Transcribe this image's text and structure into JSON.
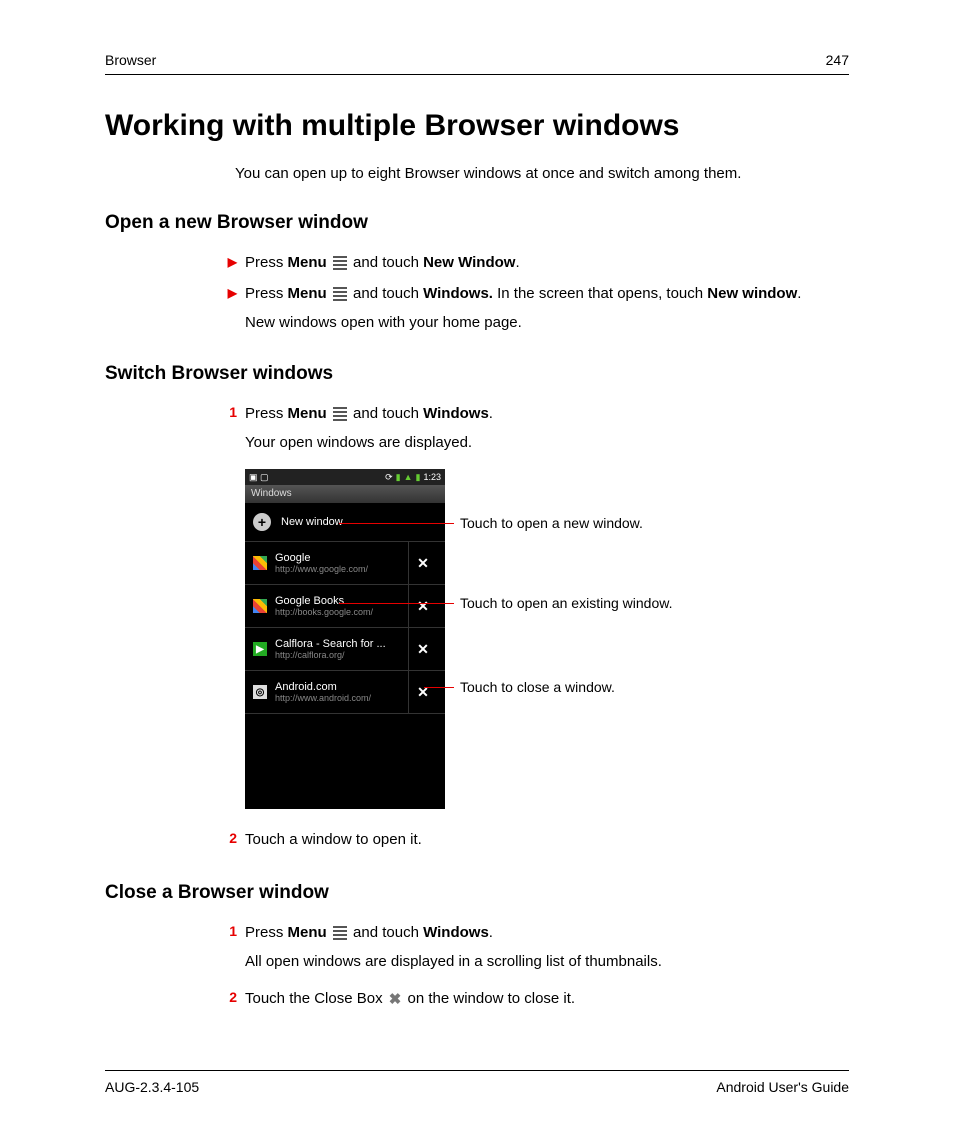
{
  "header": {
    "chapter": "Browser",
    "page_number": "247"
  },
  "title": "Working with multiple Browser windows",
  "intro": "You can open up to eight Browser windows at once and switch among them.",
  "sections": {
    "open": {
      "heading": "Open a new Browser window",
      "b1_pre": "Press ",
      "b1_menu": "Menu",
      "b1_mid": " and touch ",
      "b1_action": "New Window",
      "b1_post": ".",
      "b2_pre": "Press ",
      "b2_menu": "Menu",
      "b2_mid": " and touch ",
      "b2_action": "Windows.",
      "b2_tail": " In the screen that opens, touch ",
      "b2_action2": "New window",
      "b2_post": ".",
      "note": "New windows open with your home page."
    },
    "switch": {
      "heading": "Switch Browser windows",
      "s1_num": "1",
      "s1_pre": "Press ",
      "s1_menu": "Menu",
      "s1_mid": " and touch ",
      "s1_action": "Windows",
      "s1_post": ".",
      "s1_note": "Your open windows are displayed.",
      "s2_num": "2",
      "s2_text": "Touch a window to open it."
    },
    "close": {
      "heading": "Close a Browser window",
      "c1_num": "1",
      "c1_pre": "Press ",
      "c1_menu": "Menu",
      "c1_mid": " and touch ",
      "c1_action": "Windows",
      "c1_post": ".",
      "c1_note": "All open windows are displayed in a scrolling list of thumbnails.",
      "c2_num": "2",
      "c2_pre": "Touch the Close Box ",
      "c2_post": " on the window to close it."
    }
  },
  "phone": {
    "time": "1:23",
    "titlebar": "Windows",
    "new_window": "New window",
    "rows": [
      {
        "title": "Google",
        "url": "http://www.google.com/"
      },
      {
        "title": "Google Books",
        "url": "http://books.google.com/"
      },
      {
        "title": "Calflora - Search for ...",
        "url": "http://calflora.org/"
      },
      {
        "title": "Android.com",
        "url": "http://www.android.com/"
      }
    ]
  },
  "callouts": {
    "new": "Touch to open a new window.",
    "existing": "Touch to open an existing window.",
    "close": "Touch to close a window."
  },
  "footer": {
    "left": "AUG-2.3.4-105",
    "right": "Android User's Guide"
  }
}
